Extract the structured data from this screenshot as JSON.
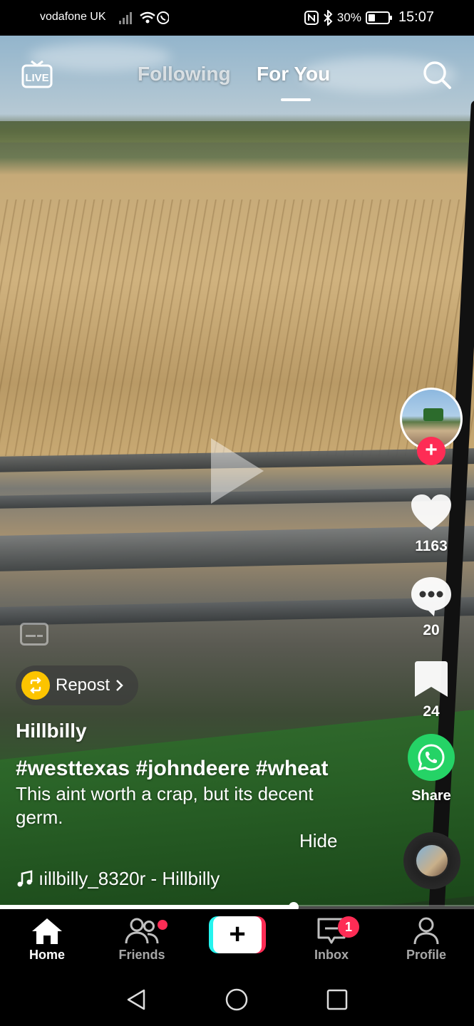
{
  "status_bar": {
    "carrier": "vodafone UK",
    "battery": "30%",
    "battery_level": 0.3,
    "time": "15:07"
  },
  "top_nav": {
    "live_label": "LIVE",
    "tabs": [
      {
        "label": "Following",
        "active": false
      },
      {
        "label": "For You",
        "active": true
      }
    ]
  },
  "post": {
    "repost_label": "Repost",
    "author": "Hillbilly",
    "hashtags": "#westtexas #johndeere #wheat",
    "description": "This aint worth a crap, but its decent germ.",
    "hide_label": "Hide",
    "sound": "ıillbilly_8320r - Hillbilly"
  },
  "actions": {
    "likes": "1163",
    "comments": "20",
    "bookmarks": "24",
    "share_label": "Share"
  },
  "playback": {
    "progress": 0.62
  },
  "bottom_nav": {
    "items": [
      {
        "label": "Home",
        "active": true
      },
      {
        "label": "Friends",
        "active": false
      },
      {
        "label": "Inbox",
        "active": false,
        "badge": "1"
      },
      {
        "label": "Profile",
        "active": false
      }
    ]
  },
  "colors": {
    "accent_red": "#fe2c55",
    "accent_cyan": "#25f4ee",
    "whatsapp_green": "#25d366",
    "repost_yellow": "#fcc400"
  },
  "icons": [
    "live-icon",
    "search-icon",
    "heart-icon",
    "comment-icon",
    "bookmark-icon",
    "whatsapp-icon",
    "music-note-icon",
    "captions-icon",
    "home-icon",
    "friends-icon",
    "inbox-icon",
    "profile-icon"
  ]
}
